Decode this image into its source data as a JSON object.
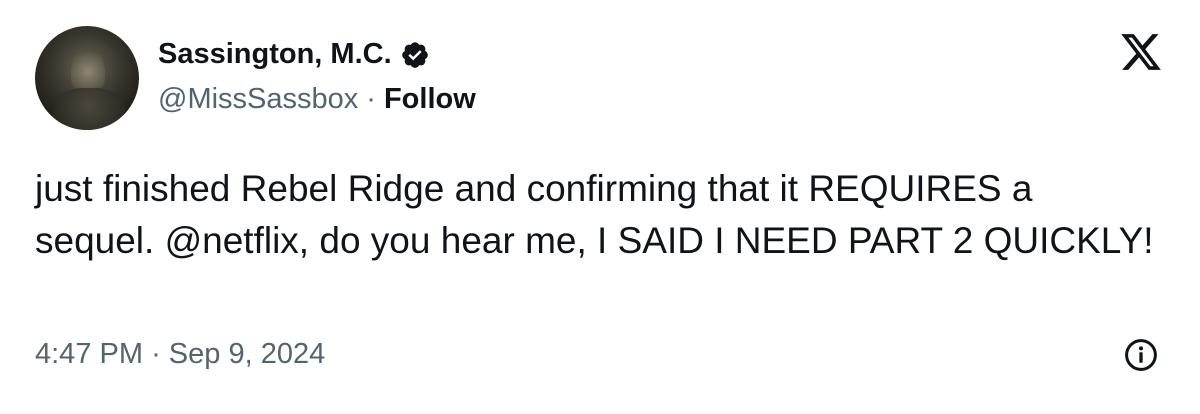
{
  "author": {
    "display_name": "Sassington, M.C.",
    "handle": "@MissSassbox",
    "separator": "·",
    "follow_label": "Follow",
    "verified_icon": "verified-badge-icon",
    "avatar_icon": "profile-photo"
  },
  "brand": {
    "logo_icon": "x-logo-icon"
  },
  "tweet": {
    "text": "just finished Rebel Ridge and confirming that it REQUIRES a sequel. @netflix, do you hear me, I SAID I NEED PART 2 QUICKLY!",
    "time": "4:47 PM",
    "separator": "·",
    "date": "Sep 9, 2024"
  },
  "footer": {
    "info_icon": "info-icon"
  },
  "colors": {
    "text_primary": "#0f1419",
    "text_secondary": "#536471",
    "background": "#ffffff"
  }
}
